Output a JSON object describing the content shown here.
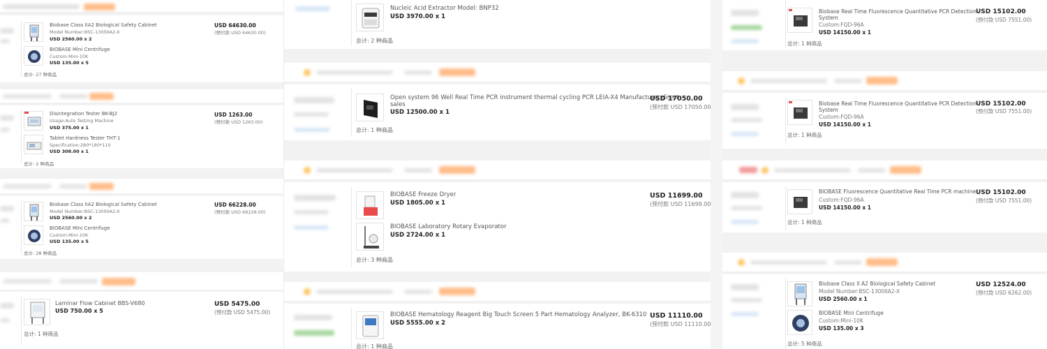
{
  "left": {
    "orders": [
      {
        "items": [
          {
            "name": "Biobase Class IIA2 Biological Safety Cabinet",
            "spec": "Model Number:BSC-1300IIA2-X",
            "price": "USD 2560.00 x 2",
            "icon": "cabinet-icon"
          },
          {
            "name": "BIOBASE Mini Centrifuge",
            "spec": "Custom:Mini-10K",
            "price": "USD 135.00 x 5",
            "icon": "centrifuge-icon"
          }
        ],
        "total_amount": "USD 64630.00",
        "prepay": "(预付款 USD 64630.00)",
        "count": "总计: 27 种商品"
      },
      {
        "items": [
          {
            "name": "Disintegration Tester BK-BJ2",
            "spec": "Usage:Auto Testing Machine",
            "price": "USD 375.00 x 1",
            "icon": "tester-icon"
          },
          {
            "name": "Tablet Hardness Tester THT-1",
            "spec": "Specification:280*180*110",
            "price": "USD 308.00 x 1",
            "icon": "hardness-tester-icon"
          }
        ],
        "total_amount": "USD 1263.00",
        "prepay": "(预付款 USD 1263.00)",
        "count": "总计: 2 种商品"
      },
      {
        "items": [
          {
            "name": "Biobase Class IIA2 Biological Safety Cabinet",
            "spec": "Model Number:BSC-1300IIA2-X",
            "price": "USD 2560.00 x 2",
            "icon": "cabinet-icon"
          },
          {
            "name": "BIOBASE Mini Centrifuge",
            "spec": "Custom:Mini-10K",
            "price": "USD 135.00 x 5",
            "icon": "centrifuge-icon"
          }
        ],
        "total_amount": "USD 66228.00",
        "prepay": "(预付款 USD 66228.00)",
        "count": "总计: 28 种商品"
      },
      {
        "items": [
          {
            "name": "Laminar Flow Cabinet BBS-V680",
            "price": "USD 750.00 x 5",
            "icon": "laminar-cabinet-icon"
          }
        ],
        "total_amount": "USD 5475.00",
        "prepay": "(预付款 USD 5475.00)",
        "count": "总计: 1 种商品"
      }
    ]
  },
  "middle": {
    "orders": [
      {
        "items": [
          {
            "name": "Nucleic Acid Extractor Model: BNP32",
            "price": "USD 3970.00 x 1",
            "icon": "extractor-icon"
          }
        ],
        "count": "总计: 2 种商品"
      },
      {
        "items": [
          {
            "name": "Open system 96 Well Real Time PCR instrument thermal cycling PCR LEIA-X4 Manufacturer direct",
            "name2": "sales",
            "price": "USD 12500.00 x 1",
            "icon": "pcr-icon"
          }
        ],
        "total_amount": "USD 17050.00",
        "prepay": "(预付款 USD 17050.00)",
        "count": "总计: 1 种商品"
      },
      {
        "items": [
          {
            "name": "BIOBASE Freeze Dryer",
            "price": "USD 1805.00 x 1",
            "icon": "freeze-dryer-icon"
          },
          {
            "name": "BIOBASE Laboratory Rotary Evaporator",
            "price": "USD 2724.00 x 1",
            "icon": "evaporator-icon"
          }
        ],
        "total_amount": "USD 11699.00",
        "prepay": "(预付款 USD 11699.00)",
        "count": "总计: 3 种商品"
      },
      {
        "items": [
          {
            "name": "BIOBASE Hematology Reagent Big Touch Screen 5 Part Hematology Analyzer, BK-6310",
            "price": "USD 5555.00 x 2",
            "icon": "analyzer-icon"
          }
        ],
        "total_amount": "USD 11110.00",
        "prepay": "(预付款 USD 11110.00)",
        "count": "总计: 1 种商品"
      }
    ]
  },
  "right": {
    "orders": [
      {
        "items": [
          {
            "name": "Biobase Real Time Fluorescence Quantitative PCR Detection",
            "name2": "System",
            "spec": "Custom:FQD-96A",
            "price": "USD 14150.00 x 1",
            "icon": "pcr-detector-icon"
          }
        ],
        "total_amount": "USD 15102.00",
        "prepay": "(预付款 USD 7551.00)",
        "count": "总计: 1 种商品"
      },
      {
        "items": [
          {
            "name": "Biobase Real Time Fluorescence Quantitative PCR Detection",
            "name2": "System",
            "spec": "Custom:FQD-96A",
            "price": "USD 14150.00 x 1",
            "icon": "pcr-detector-icon"
          }
        ],
        "total_amount": "USD 15102.00",
        "prepay": "(预付款 USD 7551.00)",
        "count": "总计: 1 种商品"
      },
      {
        "items": [
          {
            "name": "BIOBASE Fluorescence Quantitative Real Time PCR machine",
            "spec": "Custom:FQD-96A",
            "price": "USD 14150.00 x 1",
            "icon": "pcr-detector-icon"
          }
        ],
        "total_amount": "USD 15102.00",
        "prepay": "(预付款 USD 7551.00)",
        "count": "总计: 1 种商品"
      },
      {
        "items": [
          {
            "name": "Biobase Class II A2 Biological Safety Cabinet",
            "spec": "Model Number:BSC-1300IIA2-X",
            "price": "USD 2560.00 x 1",
            "icon": "cabinet-icon"
          },
          {
            "name": "BIOBASE Mini Centrifuge",
            "spec": "Custom:Mini-10K",
            "price": "USD 135.00 x 3",
            "icon": "centrifuge-icon"
          }
        ],
        "total_amount": "USD 12524.00",
        "prepay": "(预付款 USD 6262.00)",
        "count": "总计: 5 种商品"
      }
    ]
  }
}
